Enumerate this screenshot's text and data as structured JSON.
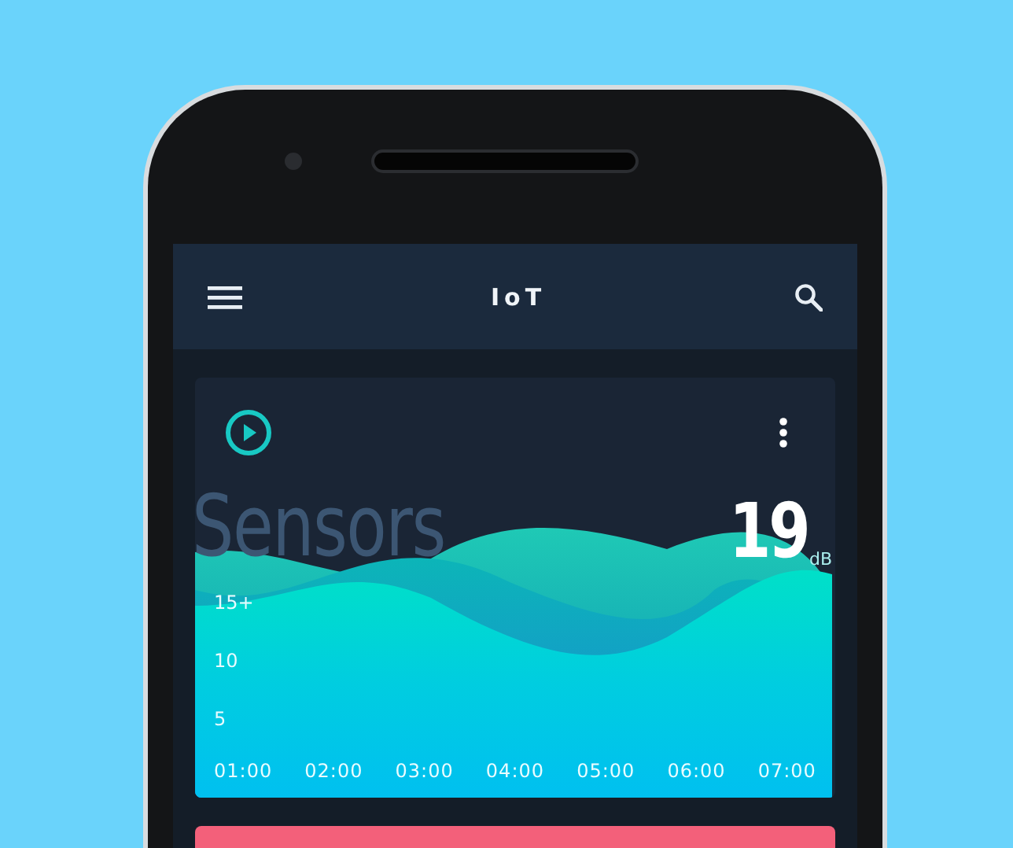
{
  "app_bar": {
    "title": "IoT"
  },
  "sensor_card": {
    "title": "Sensors",
    "reading": "19",
    "unit": "dB",
    "y_labels": [
      "15+",
      "10",
      "5"
    ],
    "x_labels": [
      "01:00",
      "02:00",
      "03:00",
      "04:00",
      "05:00",
      "06:00",
      "07:00"
    ]
  }
}
